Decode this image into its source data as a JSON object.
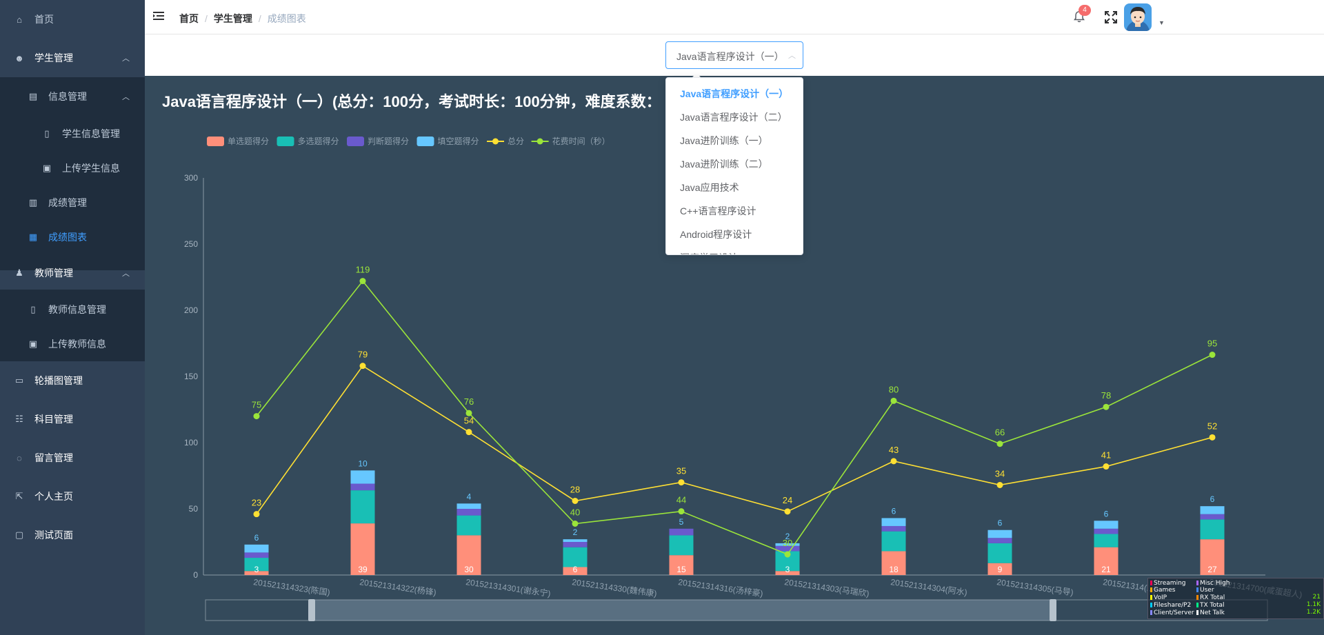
{
  "sidebar": {
    "items": [
      {
        "label": "首页"
      },
      {
        "label": "学生管理"
      },
      {
        "label": "信息管理"
      },
      {
        "label": "学生信息管理"
      },
      {
        "label": "上传学生信息"
      },
      {
        "label": "成绩管理"
      },
      {
        "label": "成绩图表"
      },
      {
        "label": "教师管理"
      },
      {
        "label": "教师信息管理"
      },
      {
        "label": "上传教师信息"
      },
      {
        "label": "轮播图管理"
      },
      {
        "label": "科目管理"
      },
      {
        "label": "留言管理"
      },
      {
        "label": "个人主页"
      },
      {
        "label": "测试页面"
      }
    ]
  },
  "breadcrumb": [
    "首页",
    "学生管理",
    "成绩图表"
  ],
  "notifications": {
    "count": "4"
  },
  "select": {
    "value": "Java语言程序设计（一）",
    "options": [
      "Java语言程序设计（一）",
      "Java语言程序设计（二）",
      "Java进阶训练（一）",
      "Java进阶训练（二）",
      "Java应用技术",
      "C++语言程序设计",
      "Android程序设计",
      "深度学习设计"
    ]
  },
  "chart_title": "Java语言程序设计（一）(总分：100分，考试时长：100分钟，难度系数：",
  "colors": {
    "sidebar_bg": "#304156",
    "submenu_bg": "#1f2d3d",
    "accent": "#409eff",
    "chart_bg": "#344a5b",
    "single": "#ff8f7a",
    "multi": "#19bfb5",
    "judge": "#6a5acd",
    "fill": "#66c7ff",
    "total": "#ffe033",
    "time": "#9be53a"
  },
  "chart_data": {
    "type": "bar",
    "title": "",
    "categories": [
      "201521314323(陈国)",
      "201521314322(杨锋)",
      "201521314301(谢永宁)",
      "201521314330(魏伟康)",
      "201521314316(汤梓豪)",
      "201521314303(马瑞欣)",
      "201521314304(阿水)",
      "201521314305(马导)",
      "201521314(...)",
      "201521314700(咸蛋超人)"
    ],
    "ylim": [
      0,
      300
    ],
    "yticks": [
      0,
      50,
      100,
      150,
      200,
      250,
      300
    ],
    "legend_position": "top-left",
    "series": [
      {
        "name": "单选题得分",
        "type": "bar",
        "stack": "score",
        "values": [
          3,
          39,
          30,
          6,
          15,
          3,
          18,
          9,
          21,
          27
        ]
      },
      {
        "name": "多选题得分",
        "type": "bar",
        "stack": "score",
        "values": [
          10,
          25,
          15,
          15,
          15,
          15,
          15,
          15,
          10,
          15
        ]
      },
      {
        "name": "判断题得分",
        "type": "bar",
        "stack": "score",
        "values": [
          4,
          5,
          5,
          4,
          5,
          4,
          4,
          4,
          4,
          4
        ]
      },
      {
        "name": "填空题得分",
        "type": "bar",
        "stack": "score",
        "values": [
          6,
          10,
          4,
          2,
          0,
          2,
          6,
          6,
          6,
          6
        ]
      },
      {
        "name": "总分",
        "type": "line",
        "values": [
          23,
          79,
          54,
          28,
          35,
          24,
          43,
          34,
          41,
          52
        ]
      },
      {
        "name": "花费时间（秒）",
        "type": "line",
        "values": [
          75,
          119,
          76,
          40,
          44,
          30,
          80,
          66,
          78,
          95
        ]
      }
    ],
    "bar_labels": {
      "single": [
        "3",
        "39",
        "30",
        "6",
        "15",
        "3",
        "18",
        "9",
        "21",
        "27"
      ],
      "fill_top": [
        "6",
        "10",
        "4",
        "2",
        "5",
        "2",
        "6",
        "6",
        "6",
        "6"
      ]
    }
  },
  "widget": {
    "rows": [
      [
        "Streaming",
        "Misc High"
      ],
      [
        "Games",
        "User"
      ],
      [
        "VoIP",
        "RX Total"
      ],
      [
        "Fileshare/P2",
        "TX Total"
      ],
      [
        "Client/Server",
        "Net Talk"
      ]
    ],
    "values": [
      "21",
      "1.1K",
      "1.2K"
    ]
  }
}
